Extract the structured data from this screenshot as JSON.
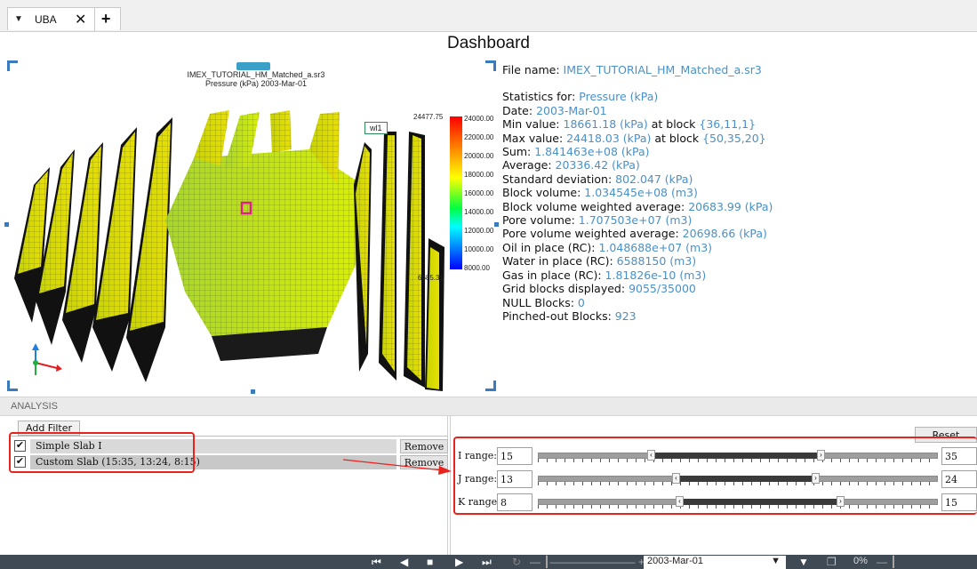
{
  "tab": {
    "label": "UBA",
    "close": "✕",
    "add": "+"
  },
  "dashboard_title": "Dashboard",
  "view3d": {
    "file_caption": "IMEX_TUTORIAL_HM_Matched_a.sr3",
    "property_caption": "Pressure (kPa)  2003-Mar-01",
    "well_label": "wl1",
    "colorbar": {
      "max_label": "24477.75",
      "min_label": "6685.31",
      "ticks": [
        "24000.00",
        "22000.00",
        "20000.00",
        "18000.00",
        "16000.00",
        "14000.00",
        "12000.00",
        "10000.00",
        "8000.00"
      ]
    }
  },
  "stats": {
    "file_name_label": "File name:",
    "file_name_value": "IMEX_TUTORIAL_HM_Matched_a.sr3",
    "rows": [
      {
        "label": "Statistics for:",
        "value": "Pressure (kPa)",
        "suffix": "",
        "value2": ""
      },
      {
        "label": "Date:",
        "value": "2003-Mar-01",
        "suffix": "",
        "value2": ""
      },
      {
        "label": "Min value:",
        "value": "18661.18 (kPa)",
        "suffix": " at block ",
        "value2": "{36,11,1}"
      },
      {
        "label": "Max value:",
        "value": "24418.03 (kPa)",
        "suffix": " at block ",
        "value2": "{50,35,20}"
      },
      {
        "label": "Sum:",
        "value": "1.841463e+08 (kPa)",
        "suffix": "",
        "value2": ""
      },
      {
        "label": "Average:",
        "value": "20336.42 (kPa)",
        "suffix": "",
        "value2": ""
      },
      {
        "label": "Standard deviation:",
        "value": "802.047 (kPa)",
        "suffix": "",
        "value2": ""
      },
      {
        "label": "Block volume:",
        "value": "1.034545e+08 (m3)",
        "suffix": "",
        "value2": ""
      },
      {
        "label": "Block volume weighted average:",
        "value": "20683.99 (kPa)",
        "suffix": "",
        "value2": ""
      },
      {
        "label": "Pore volume:",
        "value": "1.707503e+07 (m3)",
        "suffix": "",
        "value2": ""
      },
      {
        "label": "Pore volume weighted average:",
        "value": "20698.66 (kPa)",
        "suffix": "",
        "value2": ""
      },
      {
        "label": "Oil in place (RC):",
        "value": "1.048688e+07 (m3)",
        "suffix": "",
        "value2": ""
      },
      {
        "label": "Water in place (RC):",
        "value": "6588150 (m3)",
        "suffix": "",
        "value2": ""
      },
      {
        "label": "Gas in place (RC):",
        "value": "1.81826e-10 (m3)",
        "suffix": "",
        "value2": ""
      },
      {
        "label": "Grid blocks displayed:",
        "value": "9055/35000",
        "suffix": "",
        "value2": ""
      },
      {
        "label": "NULL Blocks:",
        "value": "0",
        "suffix": "",
        "value2": ""
      },
      {
        "label": "Pinched-out Blocks:",
        "value": "923",
        "suffix": "",
        "value2": ""
      }
    ]
  },
  "analysis": {
    "header": "ANALYSIS",
    "add_filter": "Add Filter",
    "filters": [
      {
        "label": "Simple Slab I",
        "checked": true,
        "remove": "Remove"
      },
      {
        "label": "Custom Slab (15:35, 13:24, 8:15)",
        "checked": true,
        "remove": "Remove"
      }
    ],
    "reset": "Reset",
    "ranges": [
      {
        "label": "I range:",
        "min": "15",
        "max": "35"
      },
      {
        "label": "J range:",
        "min": "13",
        "max": "24"
      },
      {
        "label": "K range:",
        "min": "8",
        "max": "15"
      }
    ]
  },
  "playbar": {
    "date": "2003-Mar-01",
    "zoom": "0%"
  }
}
